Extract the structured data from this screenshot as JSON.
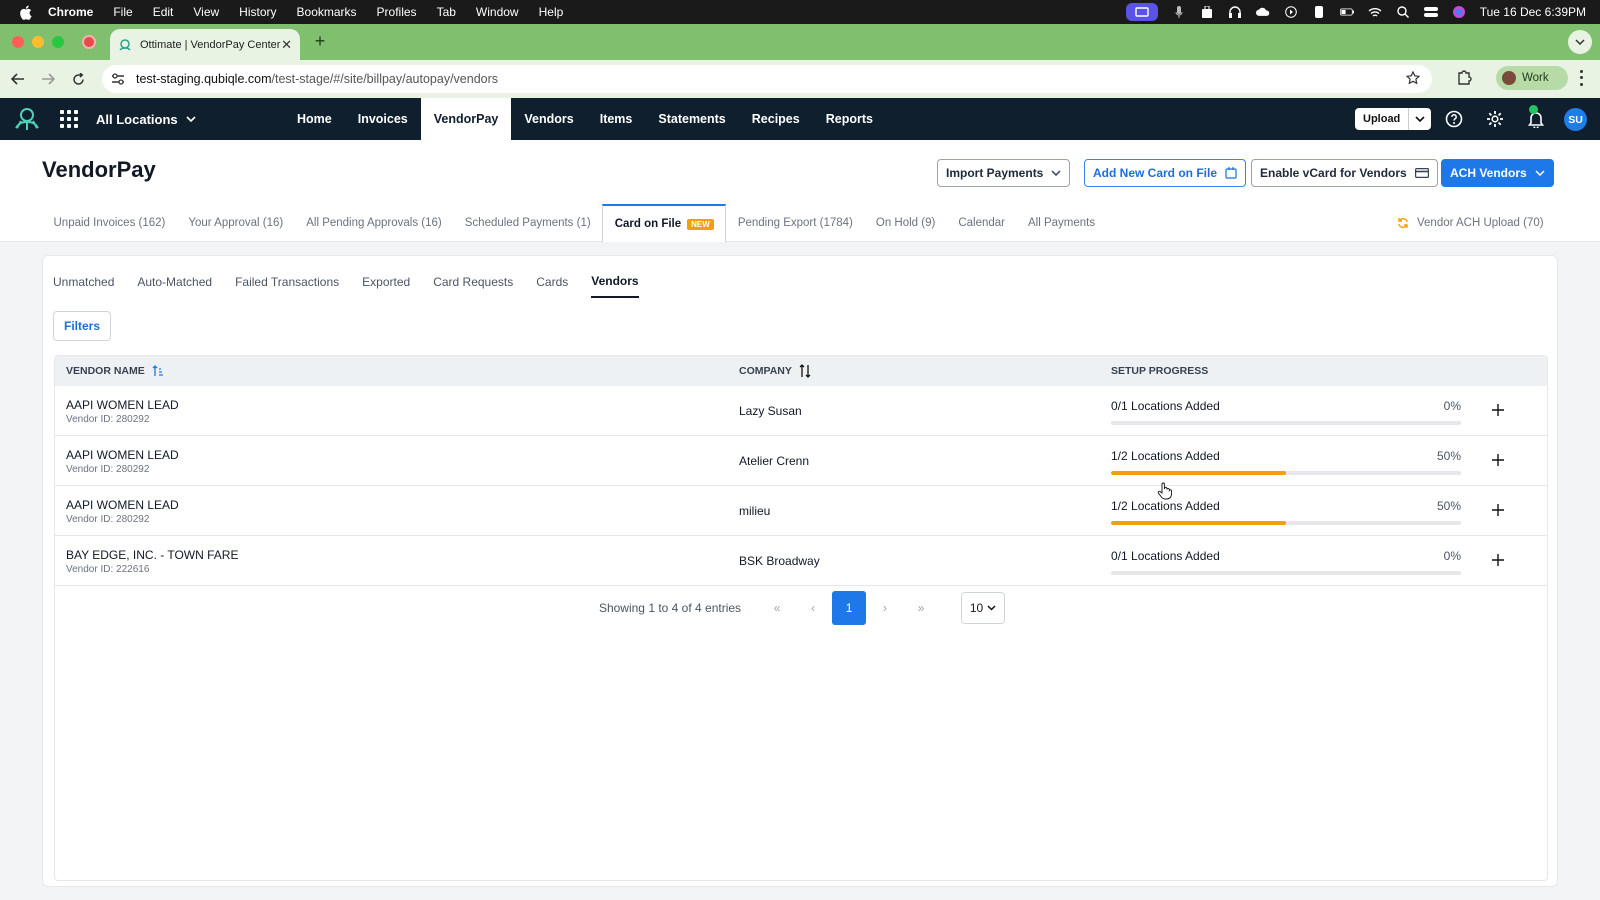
{
  "mac_menu": {
    "app": "Chrome",
    "items": [
      "File",
      "Edit",
      "View",
      "History",
      "Bookmarks",
      "Profiles",
      "Tab",
      "Window",
      "Help"
    ],
    "clock": "Tue 16 Dec  6:39PM"
  },
  "browser": {
    "tab_title": "Ottimate | VendorPay Center",
    "url_host": "test-staging.qubiqle.com",
    "url_path": "/test-stage/#/site/billpay/autopay/vendors",
    "profile": "Work"
  },
  "app_header": {
    "location_selector": "All Locations",
    "nav": [
      "Home",
      "Invoices",
      "VendorPay",
      "Vendors",
      "Items",
      "Statements",
      "Recipes",
      "Reports"
    ],
    "active_nav": "VendorPay",
    "upload": "Upload",
    "user_initials": "SU"
  },
  "page": {
    "title": "VendorPay",
    "actions": {
      "import_payments": "Import Payments",
      "add_card": "Add New Card on File",
      "enable_vcard": "Enable vCard for Vendors",
      "ach_vendors": "ACH Vendors"
    },
    "tabs": [
      "Unpaid Invoices (162)",
      "Your Approval (16)",
      "All Pending Approvals (16)",
      "Scheduled Payments (1)",
      "Card on File",
      "Pending Export (1784)",
      "On Hold (9)",
      "Calendar",
      "All Payments"
    ],
    "new_badge": "NEW",
    "ach_upload": "Vendor ACH Upload (70)"
  },
  "card": {
    "tabs": [
      "Unmatched",
      "Auto-Matched",
      "Failed Transactions",
      "Exported",
      "Card Requests",
      "Cards",
      "Vendors"
    ],
    "active_tab": "Vendors",
    "filters": "Filters",
    "columns": {
      "vendor": "VENDOR NAME",
      "company": "COMPANY",
      "progress": "SETUP PROGRESS"
    },
    "rows": [
      {
        "name": "AAPI WOMEN LEAD",
        "vendor_id": "Vendor ID: 280292",
        "company": "Lazy Susan",
        "progress_label": "0/1 Locations Added",
        "percent": "0%",
        "fraction": 0
      },
      {
        "name": "AAPI WOMEN LEAD",
        "vendor_id": "Vendor ID: 280292",
        "company": "Atelier Crenn",
        "progress_label": "1/2 Locations Added",
        "percent": "50%",
        "fraction": 0.5
      },
      {
        "name": "AAPI WOMEN LEAD",
        "vendor_id": "Vendor ID: 280292",
        "company": "milieu",
        "progress_label": "1/2 Locations Added",
        "percent": "50%",
        "fraction": 0.5
      },
      {
        "name": "BAY EDGE, INC. - TOWN FARE",
        "vendor_id": "Vendor ID: 222616",
        "company": "BSK Broadway",
        "progress_label": "0/1 Locations Added",
        "percent": "0%",
        "fraction": 0
      }
    ],
    "pagination": {
      "showing": "Showing 1 to 4 of 4 entries",
      "current_page": "1",
      "page_size": "10"
    }
  },
  "colors": {
    "brand_dark": "#0f1f2e",
    "primary": "#1e78e8",
    "progress": "#f59e0b",
    "chrome_green": "#7fbf6e"
  }
}
